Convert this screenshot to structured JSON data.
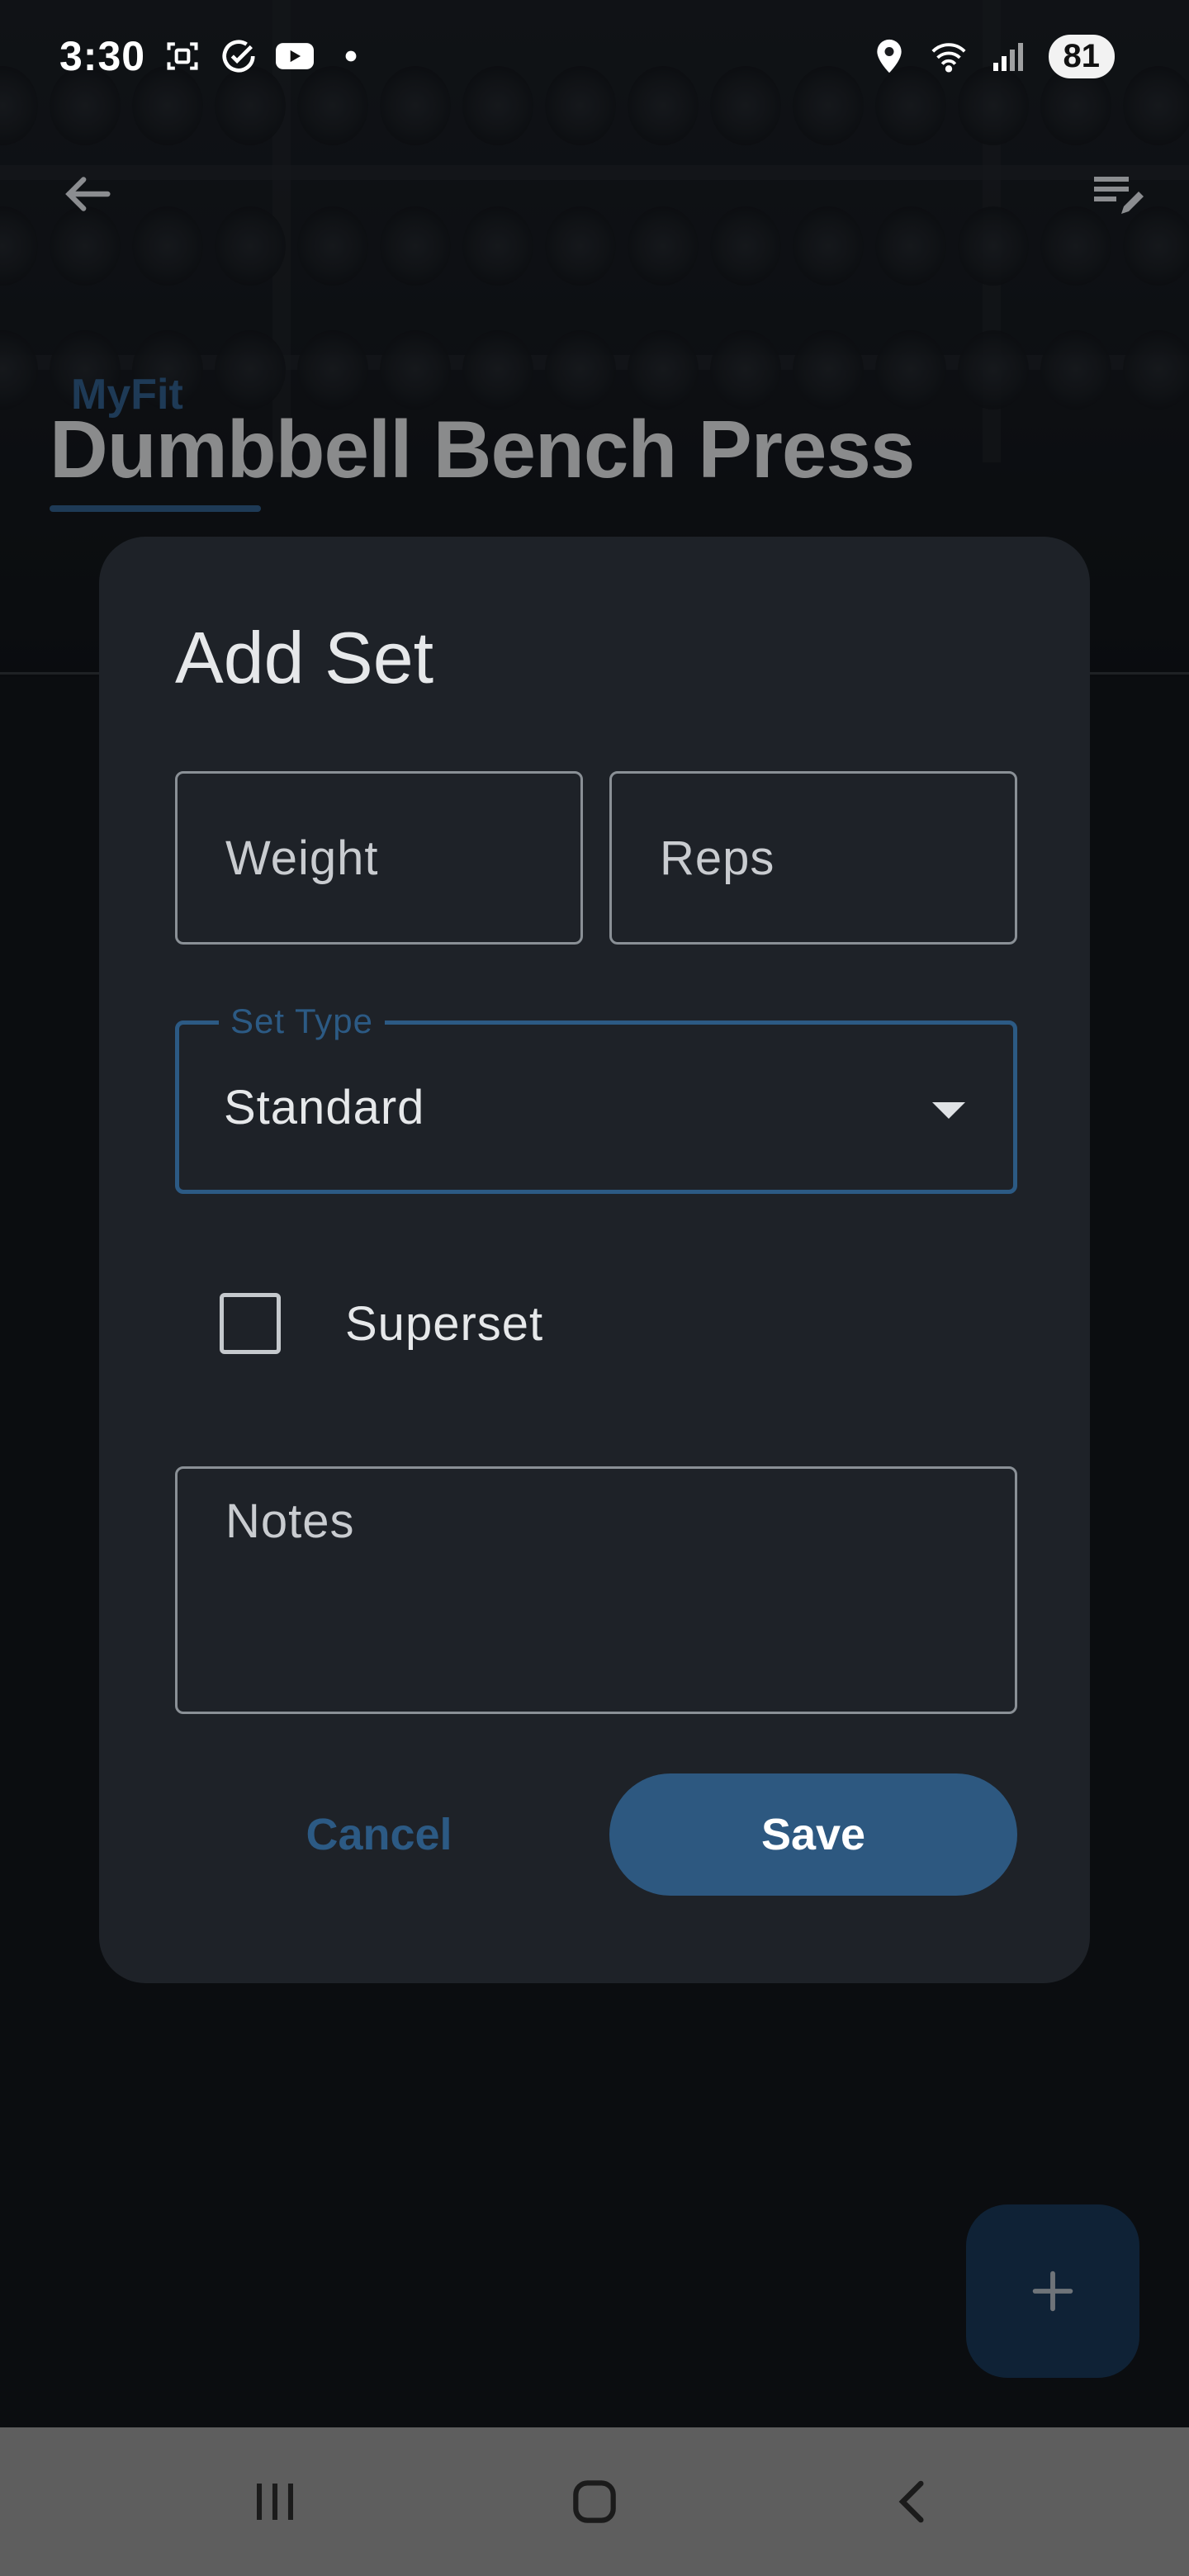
{
  "status_bar": {
    "time": "3:30",
    "battery": "81",
    "left_icons": [
      "screenshot-icon",
      "check-circle-icon",
      "youtube-icon",
      "dot-icon"
    ],
    "right_icons": [
      "location-icon",
      "wifi-icon",
      "signal-icon"
    ]
  },
  "header": {
    "brand": "MyFit",
    "title": "Dumbbell Bench Press"
  },
  "dialog": {
    "title": "Add Set",
    "weight_placeholder": "Weight",
    "reps_placeholder": "Reps",
    "set_type_label": "Set Type",
    "set_type_value": "Standard",
    "superset_label": "Superset",
    "superset_checked": false,
    "notes_placeholder": "Notes",
    "cancel_label": "Cancel",
    "save_label": "Save"
  },
  "colors": {
    "accent": "#2d5880",
    "dialog_bg": "#1e2228",
    "nav_bar": "#5e5e5e"
  },
  "nav_bar": {
    "buttons": [
      "recents-icon",
      "home-icon",
      "back-nav-icon"
    ]
  }
}
